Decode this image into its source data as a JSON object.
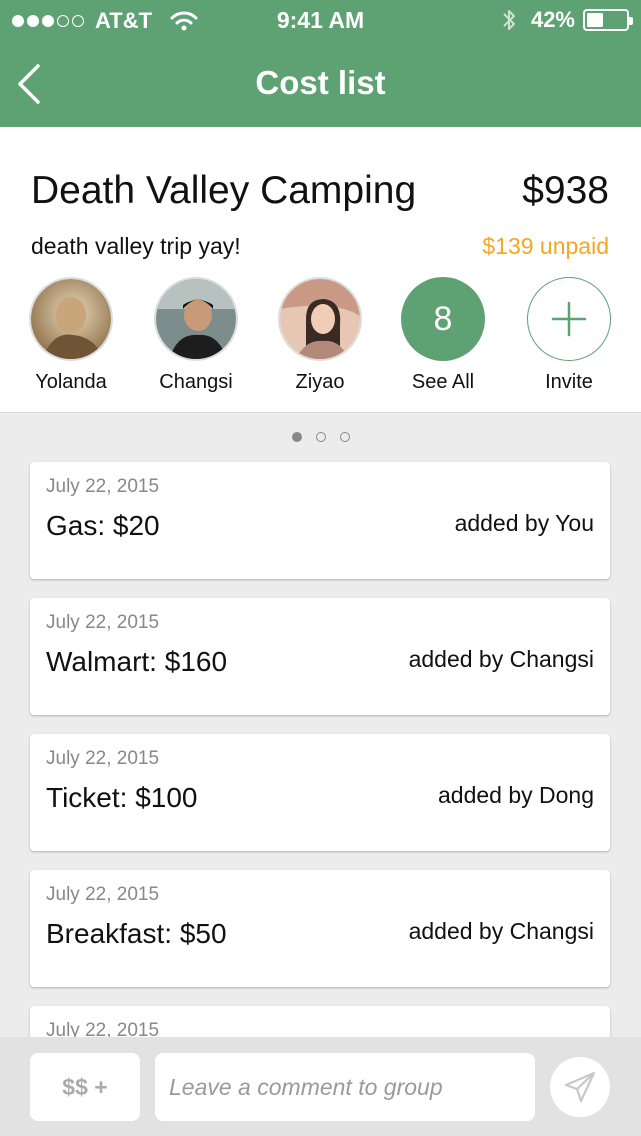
{
  "status_bar": {
    "carrier": "AT&T",
    "time": "9:41 AM",
    "battery_percent": "42%",
    "battery_level": 0.42,
    "signal_bars_filled": 3,
    "signal_bars_total": 5,
    "icons": [
      "signal-dots-icon",
      "wifi-icon",
      "bluetooth-icon",
      "battery-icon"
    ]
  },
  "nav": {
    "title": "Cost list",
    "back_icon": "chevron-left-icon"
  },
  "trip": {
    "name": "Death Valley Camping",
    "total": "$938",
    "description": "death valley trip yay!",
    "unpaid": "$139 unpaid",
    "members": [
      {
        "name": "Yolanda"
      },
      {
        "name": "Changsi"
      },
      {
        "name": "Ziyao"
      }
    ],
    "see_all": {
      "count": "8",
      "label": "See All"
    },
    "invite": {
      "label": "Invite",
      "icon": "plus-icon"
    }
  },
  "pager": {
    "pages": 3,
    "active": 0
  },
  "costs": [
    {
      "date": "July 22, 2015",
      "item": "Gas: $20",
      "added_by": "added by You"
    },
    {
      "date": "July 22, 2015",
      "item": "Walmart: $160",
      "added_by": "added by Changsi"
    },
    {
      "date": "July 22, 2015",
      "item": "Ticket: $100",
      "added_by": "added by Dong"
    },
    {
      "date": "July 22, 2015",
      "item": "Breakfast: $50",
      "added_by": "added by Changsi"
    },
    {
      "date": "July 22, 2015",
      "item": "",
      "added_by": ""
    }
  ],
  "bottom": {
    "money_button": "$$ +",
    "comment_placeholder": "Leave a comment to group",
    "send_icon": "paper-plane-icon"
  },
  "colors": {
    "brand_green": "#5ea274",
    "unpaid_orange": "#f5a623"
  }
}
